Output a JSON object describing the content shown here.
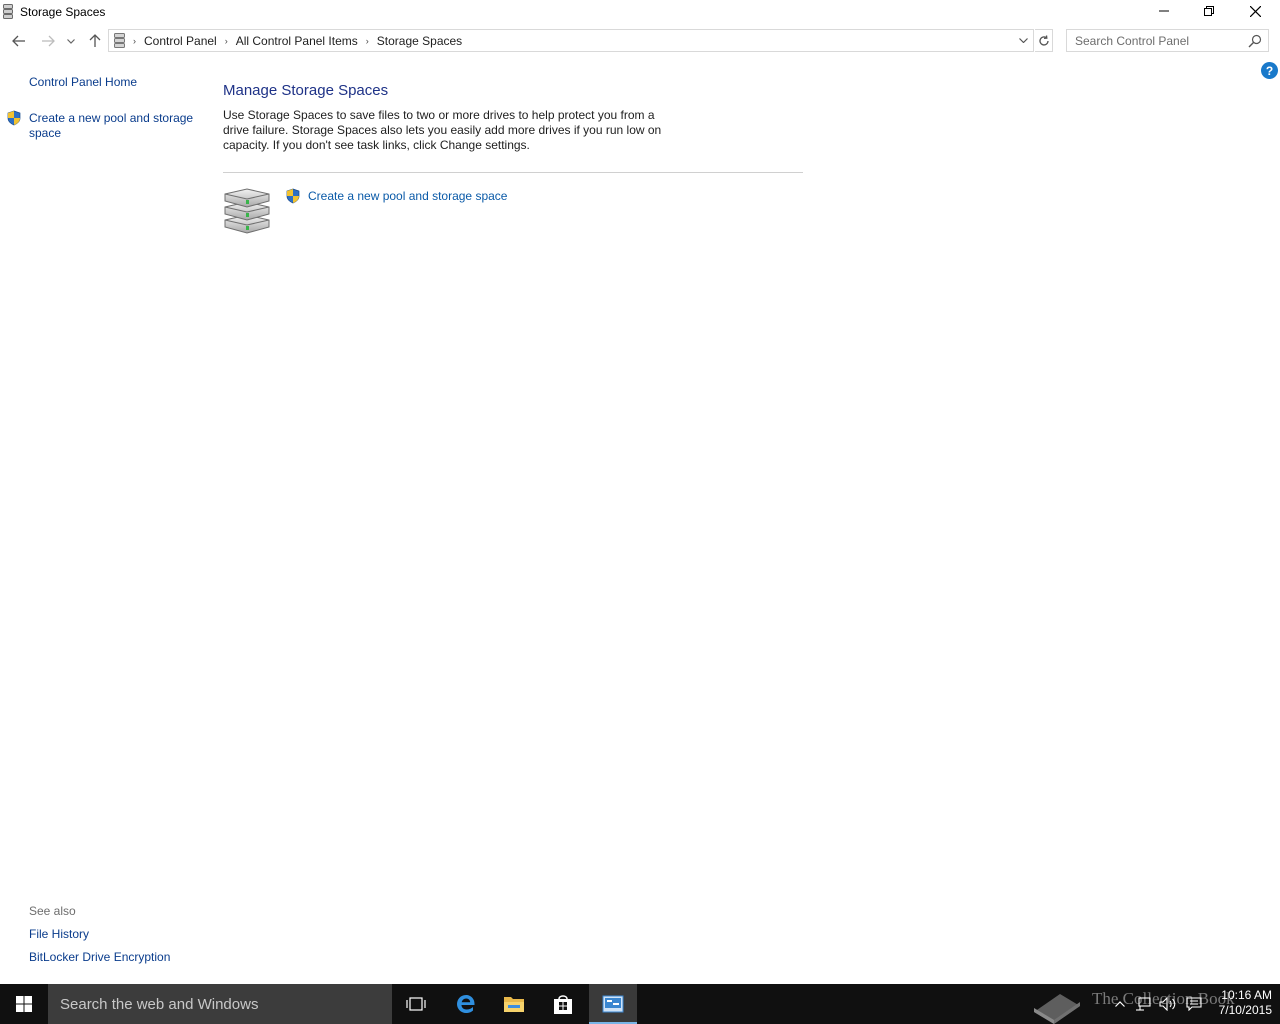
{
  "window": {
    "title": "Storage Spaces"
  },
  "navigation": {
    "breadcrumbs": [
      "Control Panel",
      "All Control Panel Items",
      "Storage Spaces"
    ],
    "search_placeholder": "Search Control Panel",
    "help_label": "?"
  },
  "left_pane": {
    "home_link": "Control Panel Home",
    "task_link": "Create a new pool and storage space",
    "see_also_title": "See also",
    "see_also_links": [
      "File History",
      "BitLocker Drive Encryption"
    ]
  },
  "main": {
    "title": "Manage Storage Spaces",
    "description": "Use Storage Spaces to save files to two or more drives to help protect you from a drive failure. Storage Spaces also lets you easily add more drives if you run low on capacity. If you don't see task links, click Change settings.",
    "task_link": "Create a new pool and storage space"
  },
  "taskbar": {
    "search_placeholder": "Search the web and Windows",
    "watermark": "The Collection Book",
    "clock_time": "10:16 AM",
    "clock_date": "7/10/2015"
  },
  "colors": {
    "link": "#0a3c8c",
    "heading": "#1e3287",
    "taskbar": "#101010",
    "accent": "#78b4e6"
  }
}
